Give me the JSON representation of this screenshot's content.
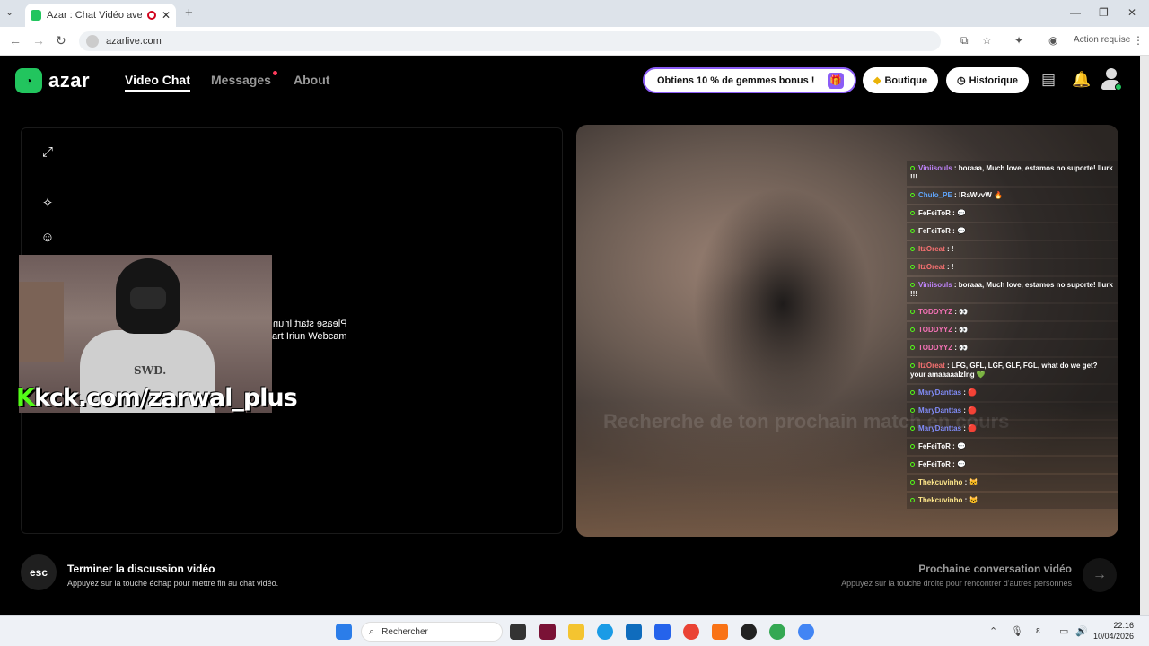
{
  "browser": {
    "tab_title": "Azar : Chat Vidéo avec de n",
    "url": "azarlive.com",
    "action_required": "Action requise"
  },
  "header": {
    "logo_text": "azar",
    "nav": [
      {
        "label": "Video Chat"
      },
      {
        "label": "Messages"
      },
      {
        "label": "About"
      }
    ],
    "promo": "Obtiens 10 % de gemmes bonus !",
    "boutique": "Boutique",
    "historique": "Historique"
  },
  "stream": {
    "overlay_text": "kick.com/zarwal_plus",
    "overlay_k": "K",
    "overlay_rest": "kck.com/zarwal_plus",
    "mirror_line1": "Please start Iriun",
    "mirror_line2": "art Iriun Webcam",
    "hoodie_print": "SWD."
  },
  "right": {
    "searching": "Recherche de ton prochain match en cours"
  },
  "chat": [
    {
      "user": "Viniisouls",
      "color": "#c084fc",
      "text": "boraaa, Much love, estamos no suporte! llurk !!!"
    },
    {
      "user": "Chulo_PE",
      "color": "#60a5fa",
      "text": "!RaWvvW 🔥"
    },
    {
      "user": "FeFeiToR",
      "color": "#ffffff",
      "text": "💬"
    },
    {
      "user": "FeFeiToR",
      "color": "#ffffff",
      "text": "💬"
    },
    {
      "user": "ItzOreat",
      "color": "#f87171",
      "text": "!"
    },
    {
      "user": "ItzOreat",
      "color": "#f87171",
      "text": "!"
    },
    {
      "user": "Viniisouls",
      "color": "#c084fc",
      "text": "boraaa, Much love, estamos no suporte! llurk !!!"
    },
    {
      "user": "TODDYYZ",
      "color": "#f472b6",
      "text": "👀"
    },
    {
      "user": "TODDYYZ",
      "color": "#f472b6",
      "text": "👀"
    },
    {
      "user": "TODDYYZ",
      "color": "#f472b6",
      "text": "👀"
    },
    {
      "user": "ItzOreat",
      "color": "#f87171",
      "text": "LFG, GFL, LGF, GLF, FGL, what do we get? your amaaaaalzIng 💚"
    },
    {
      "user": "MaryDanttas",
      "color": "#818cf8",
      "text": "🔴"
    },
    {
      "user": "MaryDanttas",
      "color": "#818cf8",
      "text": "🔴"
    },
    {
      "user": "MaryDanttas",
      "color": "#818cf8",
      "text": "🔴"
    },
    {
      "user": "FeFeiToR",
      "color": "#ffffff",
      "text": "💬"
    },
    {
      "user": "FeFeiToR",
      "color": "#ffffff",
      "text": "💬"
    },
    {
      "user": "Thekcuvinho",
      "color": "#fde68a",
      "text": "😺"
    },
    {
      "user": "Thekcuvinho",
      "color": "#fde68a",
      "text": "😺"
    }
  ],
  "bottom": {
    "esc": "esc",
    "end_title": "Terminer la discussion vidéo",
    "end_sub": "Appuyez sur la touche échap pour mettre fin au chat vidéo.",
    "next_title": "Prochaine conversation vidéo",
    "next_sub": "Appuyez sur la touche droite pour rencontrer d'autres personnes"
  },
  "taskbar": {
    "search": "Rechercher",
    "time": "22:16",
    "date": "10/04/2026"
  },
  "colors": {
    "brand": "#22c55e",
    "promo_border": "#8b5cf6",
    "kick_green": "#53fc18"
  }
}
